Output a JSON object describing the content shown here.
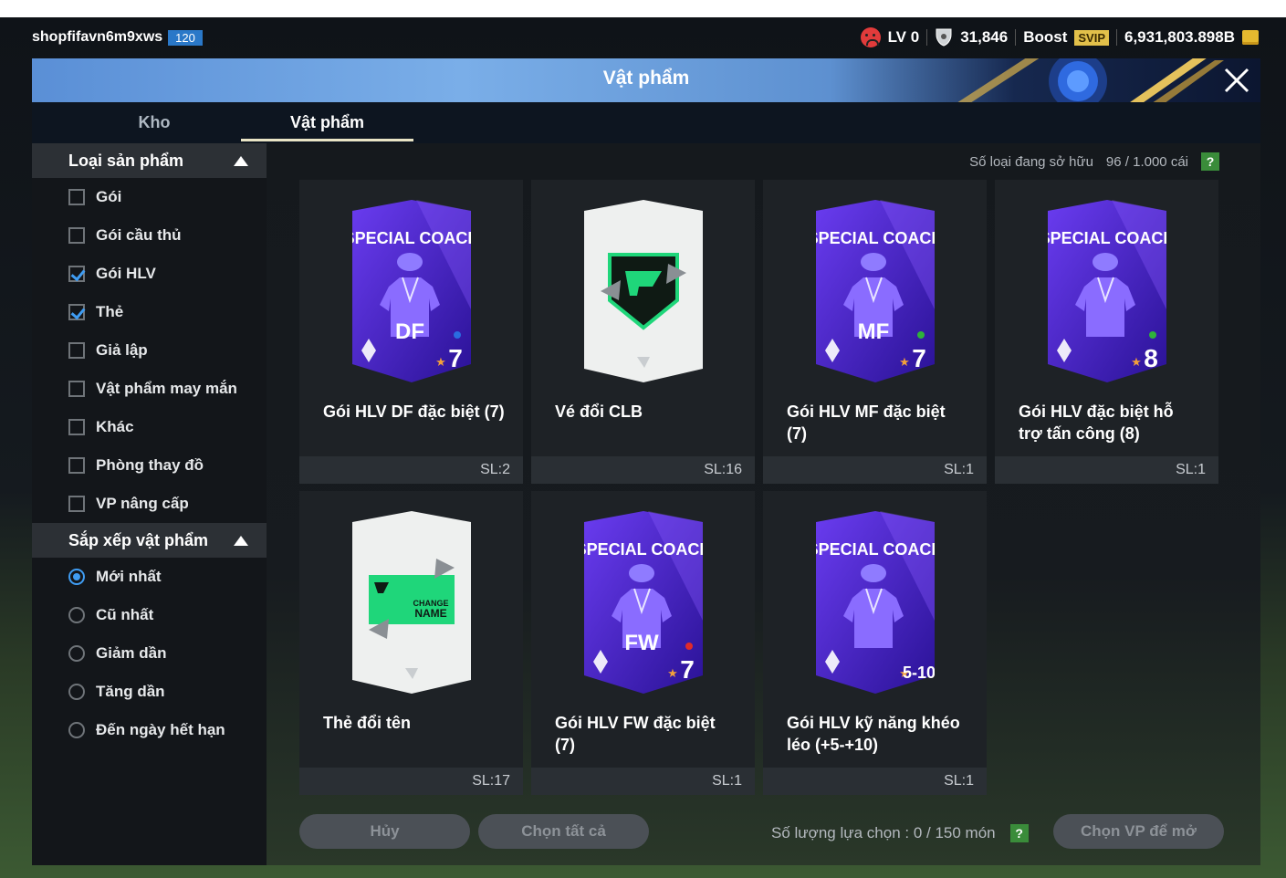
{
  "user": {
    "name": "shopfifavn6m9xws",
    "level": "120"
  },
  "stats": {
    "lv": "LV 0",
    "shield_value": "31,846",
    "boost": "Boost",
    "svip": "SVIP",
    "coins": "6,931,803.898B"
  },
  "window": {
    "title": "Vật phẩm"
  },
  "tabs": [
    {
      "label": "Kho"
    },
    {
      "label": "Vật phẩm"
    }
  ],
  "filter": {
    "title": "Loại sản phẩm",
    "options": [
      {
        "label": "Gói",
        "checked": false
      },
      {
        "label": "Gói cầu thủ",
        "checked": false
      },
      {
        "label": "Gói HLV",
        "checked": true
      },
      {
        "label": "Thẻ",
        "checked": true
      },
      {
        "label": "Giả lập",
        "checked": false
      },
      {
        "label": "Vật phẩm may mắn",
        "checked": false
      },
      {
        "label": "Khác",
        "checked": false
      },
      {
        "label": "Phòng thay đồ",
        "checked": false
      },
      {
        "label": "VP nâng cấp",
        "checked": false
      }
    ]
  },
  "sort": {
    "title": "Sắp xếp vật phẩm",
    "options": [
      {
        "label": "Mới nhất",
        "selected": true
      },
      {
        "label": "Cũ nhất",
        "selected": false
      },
      {
        "label": "Giảm dần",
        "selected": false
      },
      {
        "label": "Tăng dần",
        "selected": false
      },
      {
        "label": "Đến ngày hết hạn",
        "selected": false
      }
    ]
  },
  "owned": {
    "label": "Số loại đang sở hữu",
    "value": "96 / 1.000 cái",
    "help": "?"
  },
  "items": [
    {
      "kind": "coach",
      "banner": "SPECIAL COACH",
      "pos": "DF",
      "grade": "7",
      "name": "Gói HLV DF đặc biệt (7)",
      "qty": "SL:2",
      "dot": "#2a6de0"
    },
    {
      "kind": "club",
      "name": "Vé đổi CLB",
      "qty": "SL:16"
    },
    {
      "kind": "coach",
      "banner": "SPECIAL COACH",
      "pos": "MF",
      "grade": "7",
      "name": "Gói HLV MF đặc biệt (7)",
      "qty": "SL:1",
      "dot": "#2fb23a"
    },
    {
      "kind": "coach",
      "banner": "SPECIAL COACH",
      "pos": "",
      "grade": "8",
      "name": "Gói HLV đặc biệt hỗ trợ tấn công (8)",
      "qty": "SL:1",
      "dot": "#2fb23a"
    },
    {
      "kind": "rename",
      "tag1": "CHANGE",
      "tag2": "NAME",
      "name": "Thẻ đổi tên",
      "qty": "SL:17"
    },
    {
      "kind": "coach",
      "banner": "SPECIAL COACH",
      "pos": "FW",
      "grade": "7",
      "name": "Gói HLV FW đặc biệt (7)",
      "qty": "SL:1",
      "dot": "#e02a2a"
    },
    {
      "kind": "coach",
      "banner": "SPECIAL COACH",
      "pos": "",
      "grade": "5-10",
      "name": "Gói HLV kỹ năng khéo léo (+5-+10)",
      "qty": "SL:1",
      "dot": ""
    }
  ],
  "actions": {
    "cancel": "Hủy",
    "select_all": "Chọn tất cả",
    "selection_label": "Số lượng lựa chọn : 0 / 150 món",
    "help": "?",
    "open": "Chọn VP để mở"
  },
  "colors": {
    "checkbox_accent": "#3f9cf2",
    "card_purple": "#5a2fd6",
    "help_green": "#3a8c3a"
  }
}
